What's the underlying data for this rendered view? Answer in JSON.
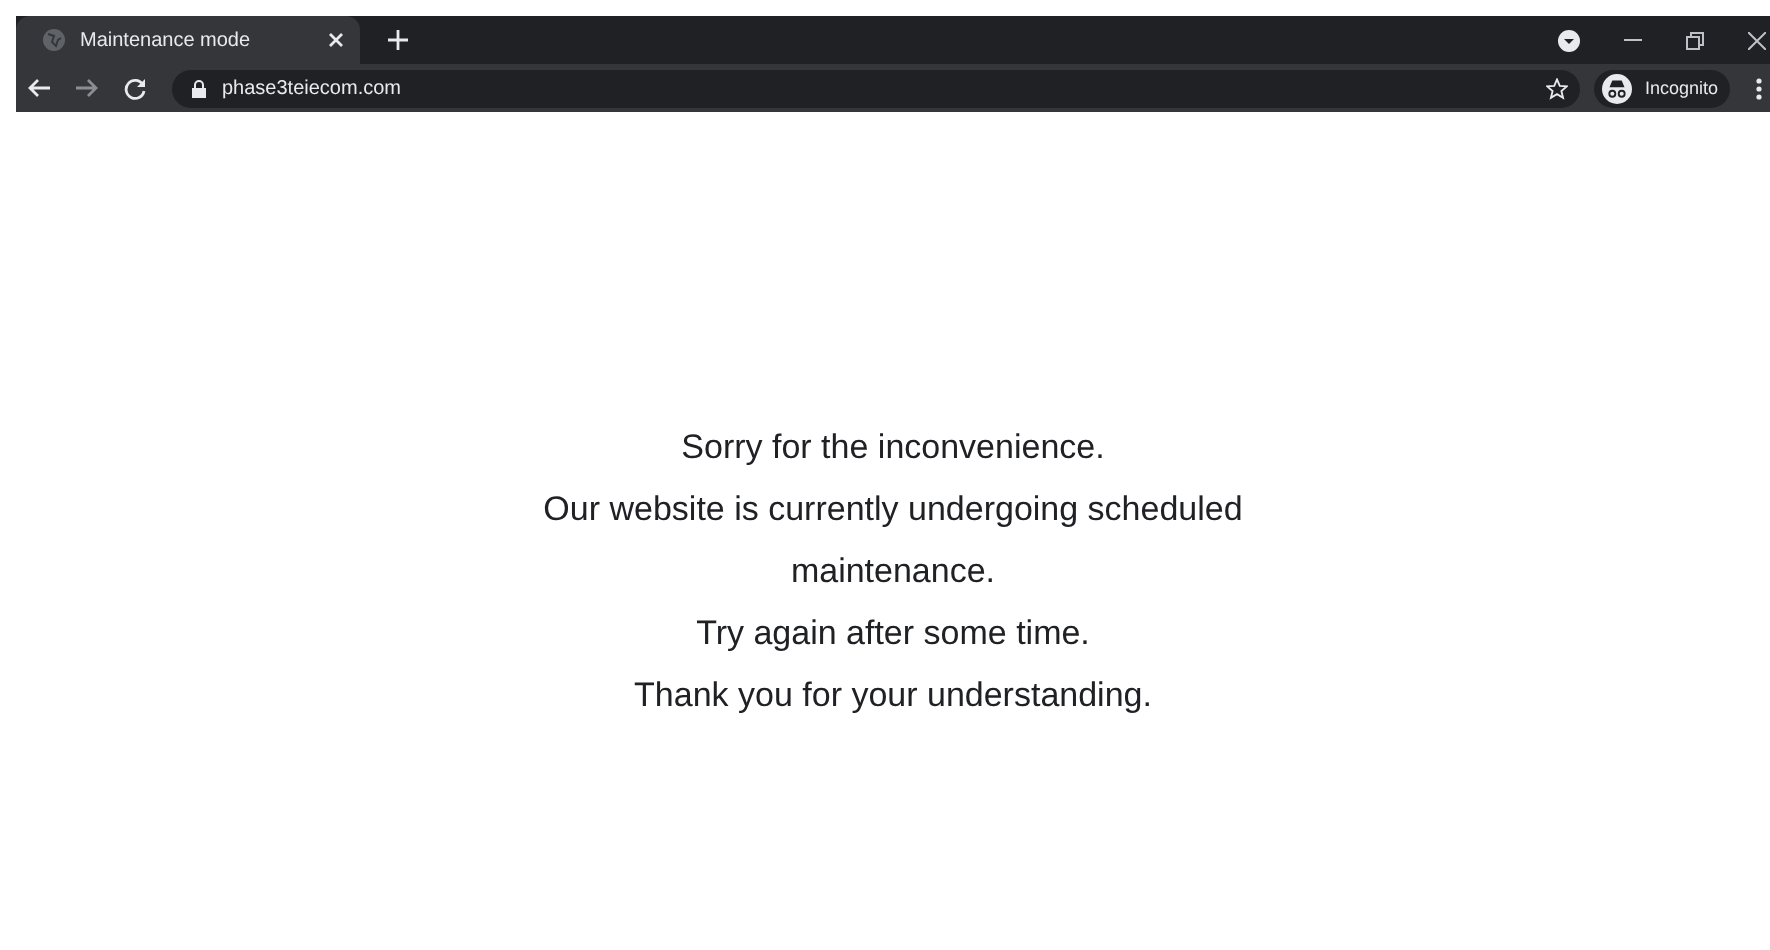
{
  "tab": {
    "title": "Maintenance mode",
    "selected": true
  },
  "address_bar": {
    "url": "phase3teiecom.com"
  },
  "profile": {
    "label": "Incognito"
  },
  "message": [
    "Sorry for the inconvenience.",
    "Our website is currently undergoing scheduled maintenance.",
    "Try again after some time.",
    "Thank you for your understanding."
  ]
}
